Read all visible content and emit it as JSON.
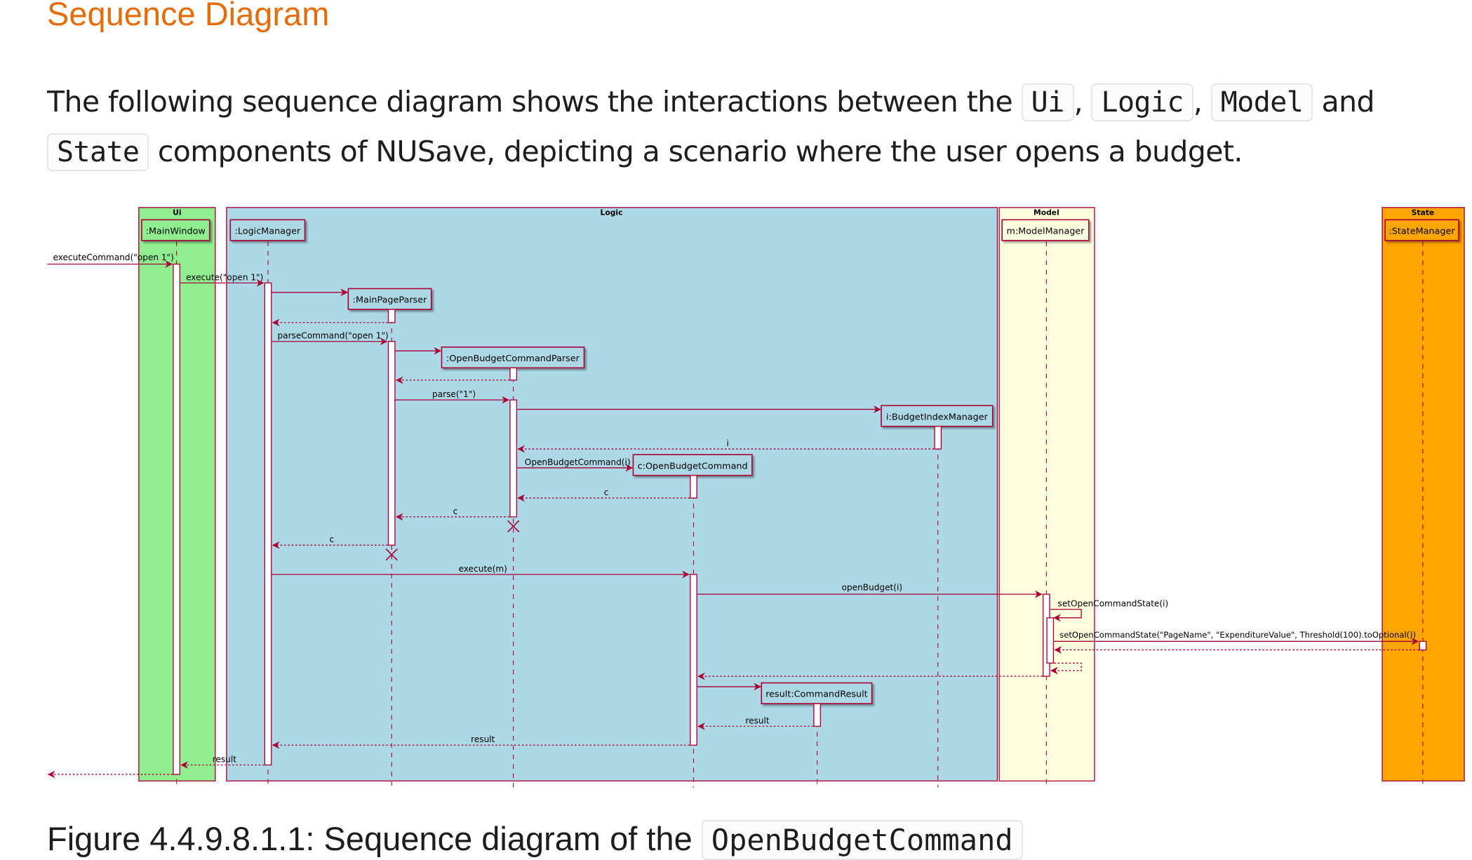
{
  "heading": "Sequence Diagram",
  "paragraph": {
    "part1": "The following sequence diagram shows the interactions between the ",
    "code_ui": "Ui",
    "sep1": ", ",
    "code_logic": "Logic",
    "sep2": ", ",
    "code_model": "Model",
    "part2": " and ",
    "code_state": "State",
    "part3": " components of NUSave, depicting a scenario where the user opens a budget."
  },
  "caption": {
    "text": "Figure 4.4.9.8.1.1: Sequence diagram of the ",
    "code": "OpenBudgetCommand"
  },
  "diagram": {
    "colors": {
      "ui_box": "#90ee90",
      "logic_box": "#add8e6",
      "model_box": "#ffffe0",
      "state_box": "#ffa500",
      "line": "#a80036"
    },
    "boxes": [
      {
        "id": "ui",
        "title": "Ui"
      },
      {
        "id": "logic",
        "title": "Logic"
      },
      {
        "id": "model",
        "title": "Model"
      },
      {
        "id": "state",
        "title": "State"
      }
    ],
    "participants": [
      {
        "id": "mw",
        "label": ":MainWindow"
      },
      {
        "id": "lm",
        "label": ":LogicManager"
      },
      {
        "id": "mpp",
        "label": ":MainPageParser"
      },
      {
        "id": "obcp",
        "label": ":OpenBudgetCommandParser"
      },
      {
        "id": "bim",
        "label": "i:BudgetIndexManager"
      },
      {
        "id": "obc",
        "label": "c:OpenBudgetCommand"
      },
      {
        "id": "cr",
        "label": "result:CommandResult"
      },
      {
        "id": "mm",
        "label": "m:ModelManager"
      },
      {
        "id": "sm",
        "label": ":StateManager"
      }
    ],
    "messages": [
      {
        "from": "external",
        "to": "mw",
        "label": "executeCommand(\"open 1\")",
        "type": "sync"
      },
      {
        "from": "mw",
        "to": "lm",
        "label": "execute(\"open 1\")",
        "type": "sync"
      },
      {
        "from": "lm",
        "to": "mpp",
        "label": "",
        "type": "create"
      },
      {
        "from": "mpp",
        "to": "lm",
        "label": "",
        "type": "return"
      },
      {
        "from": "lm",
        "to": "mpp",
        "label": "parseCommand(\"open 1\")",
        "type": "sync"
      },
      {
        "from": "mpp",
        "to": "obcp",
        "label": "",
        "type": "create"
      },
      {
        "from": "obcp",
        "to": "mpp",
        "label": "",
        "type": "return"
      },
      {
        "from": "mpp",
        "to": "obcp",
        "label": "parse(\"1\")",
        "type": "sync"
      },
      {
        "from": "obcp",
        "to": "bim",
        "label": "",
        "type": "create"
      },
      {
        "from": "bim",
        "to": "obcp",
        "label": "i",
        "type": "return"
      },
      {
        "from": "obcp",
        "to": "obc",
        "label": "OpenBudgetCommand(i)",
        "type": "create"
      },
      {
        "from": "obc",
        "to": "obcp",
        "label": "c",
        "type": "return"
      },
      {
        "from": "obcp",
        "to": "mpp",
        "label": "c",
        "type": "return"
      },
      {
        "from": "mpp",
        "to": "lm",
        "label": "c",
        "type": "return"
      },
      {
        "from": "lm",
        "to": "obc",
        "label": "execute(m)",
        "type": "sync"
      },
      {
        "from": "obc",
        "to": "mm",
        "label": "openBudget(i)",
        "type": "sync"
      },
      {
        "from": "mm",
        "to": "mm",
        "label": "setOpenCommandState(i)",
        "type": "self"
      },
      {
        "from": "mm",
        "to": "sm",
        "label": "setOpenCommandState(\"PageName\", \"ExpenditureValue\", Threshold(100).toOptional())",
        "type": "sync"
      },
      {
        "from": "sm",
        "to": "mm",
        "label": "",
        "type": "return"
      },
      {
        "from": "mm",
        "to": "mm",
        "label": "",
        "type": "self-return"
      },
      {
        "from": "mm",
        "to": "obc",
        "label": "",
        "type": "return"
      },
      {
        "from": "obc",
        "to": "cr",
        "label": "",
        "type": "create"
      },
      {
        "from": "cr",
        "to": "obc",
        "label": "result",
        "type": "return"
      },
      {
        "from": "obc",
        "to": "lm",
        "label": "result",
        "type": "return"
      },
      {
        "from": "lm",
        "to": "mw",
        "label": "result",
        "type": "return"
      },
      {
        "from": "mw",
        "to": "external",
        "label": "",
        "type": "return"
      }
    ]
  }
}
